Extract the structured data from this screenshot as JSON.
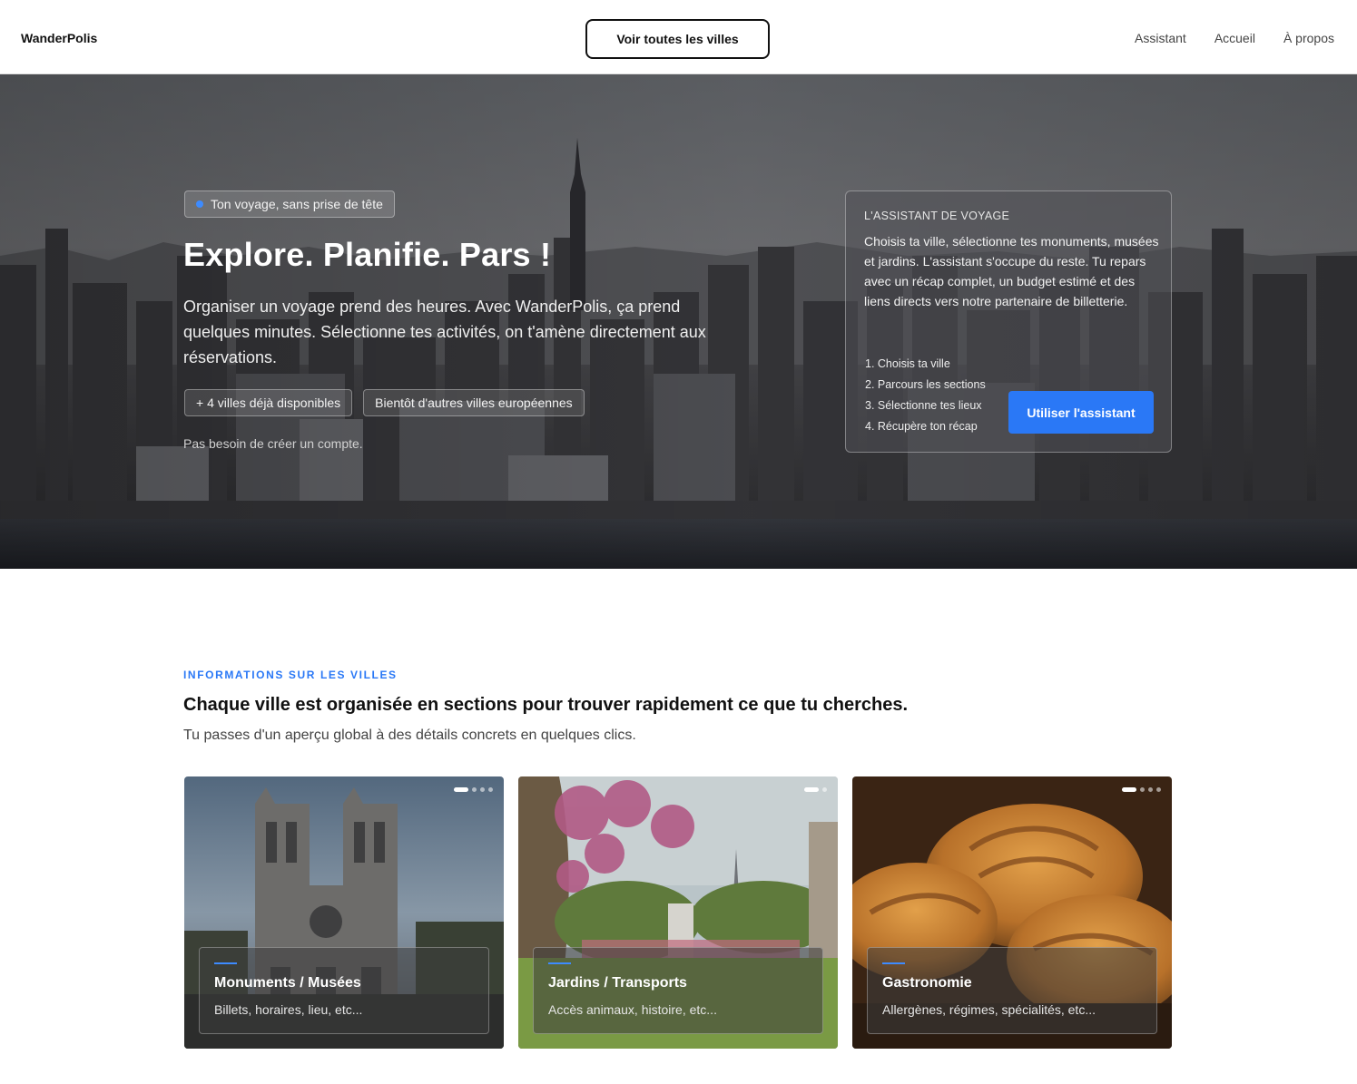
{
  "header": {
    "logo": "WanderPolis",
    "cta": "Voir toutes les villes",
    "nav": [
      "Assistant",
      "Accueil",
      "À propos"
    ]
  },
  "hero": {
    "badge": "Ton voyage, sans prise de tête",
    "title": "Explore. Planifie. Pars !",
    "subtitle": "Organiser un voyage prend des heures. Avec WanderPolis, ça prend quelques minutes. Sélectionne tes activités, on t'amène directement aux réservations.",
    "chips": [
      "+ 4 villes déjà disponibles",
      "Bientôt d'autres villes européennes"
    ],
    "note": "Pas besoin de créer un compte."
  },
  "assistant": {
    "kicker": "L'ASSISTANT DE VOYAGE",
    "description": "Choisis ta ville, sélectionne tes monuments, musées et jardins. L'assistant s'occupe du reste. Tu repars avec un récap complet, un budget estimé et des liens directs vers notre partenaire de billetterie.",
    "steps": [
      "1. Choisis ta ville",
      "2. Parcours les sections",
      "3. Sélectionne tes lieux",
      "4. Récupère ton récap"
    ],
    "button": "Utiliser l'assistant"
  },
  "cities_section": {
    "kicker": "INFORMATIONS SUR LES VILLES",
    "title": "Chaque ville est organisée en sections pour trouver rapidement ce que tu cherches.",
    "subtitle": "Tu passes d'un aperçu global à des détails concrets en quelques clics.",
    "cards": [
      {
        "title": "Monuments / Musées",
        "subtitle": "Billets, horaires, lieu, etc...",
        "slides": 4
      },
      {
        "title": "Jardins / Transports",
        "subtitle": "Accès animaux, histoire, etc...",
        "slides": 2
      },
      {
        "title": "Gastronomie",
        "subtitle": "Allergènes, régimes, spécialités, etc...",
        "slides": 4
      }
    ]
  },
  "colors": {
    "accent": "#2a78f6",
    "text": "#111111"
  },
  "icons": {
    "badge_marker": "blue-dot-icon"
  }
}
